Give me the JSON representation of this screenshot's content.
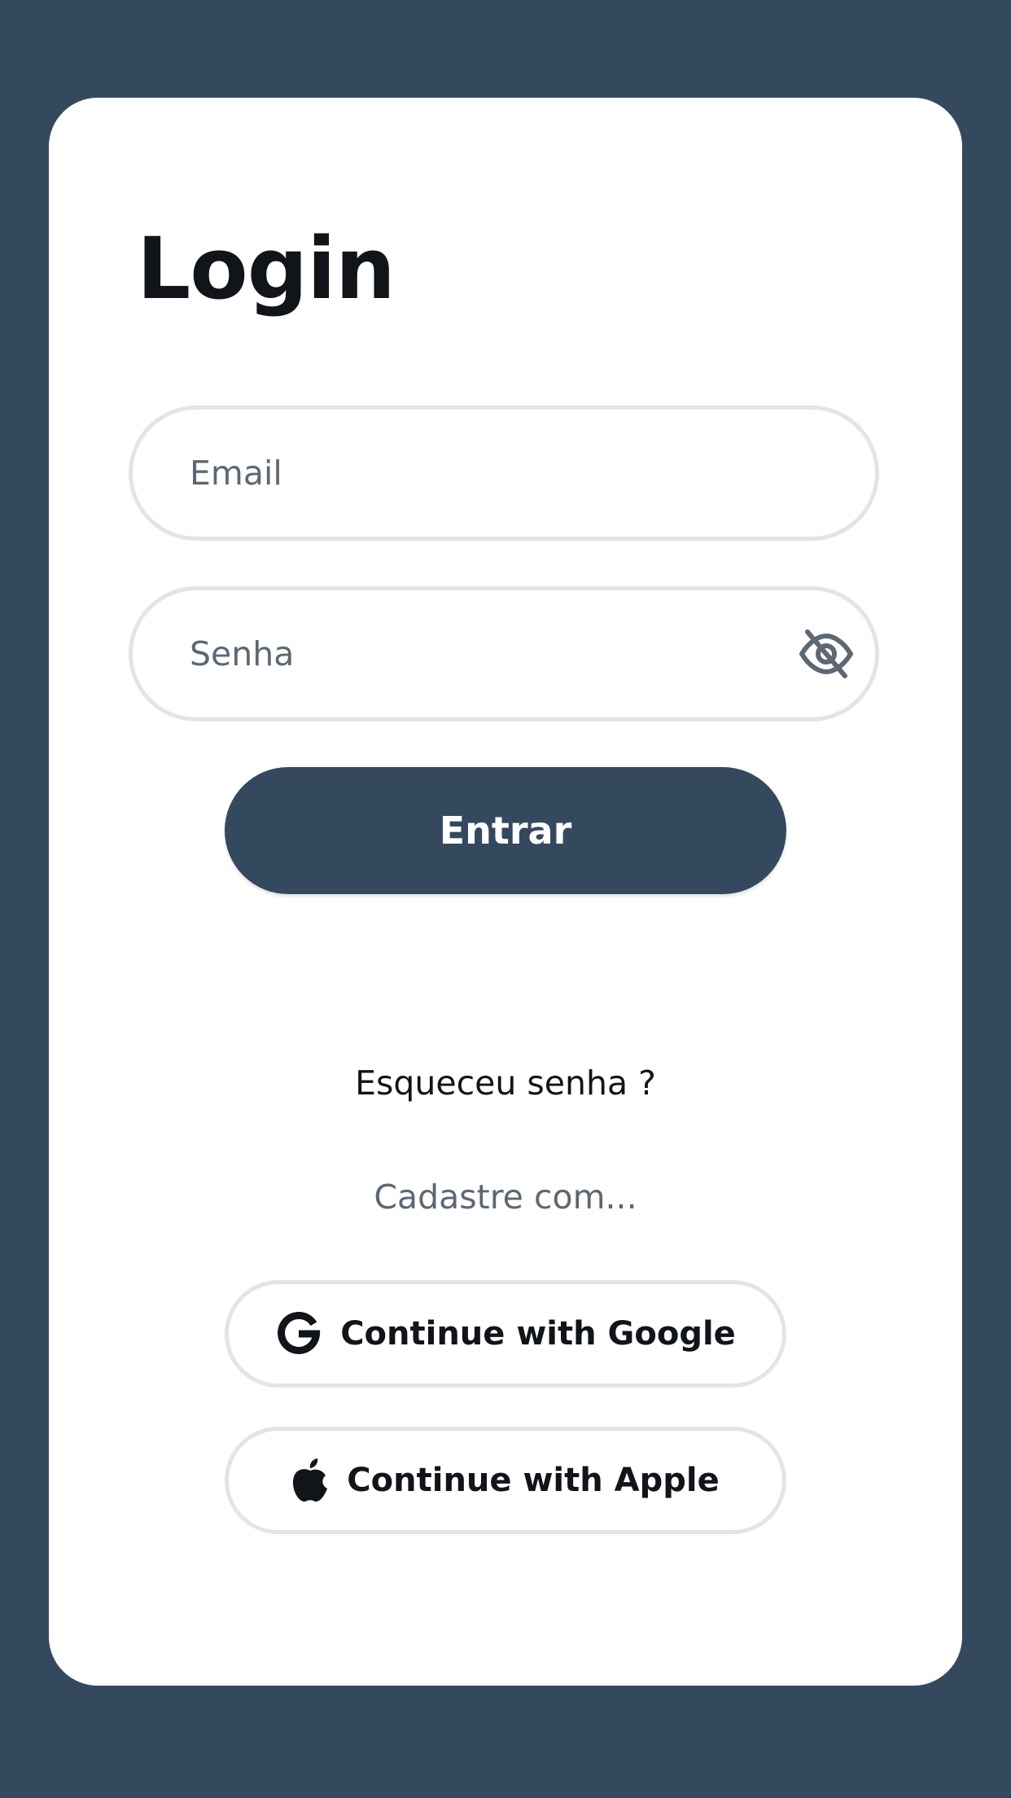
{
  "login": {
    "title": "Login",
    "email": {
      "placeholder": "Email",
      "value": ""
    },
    "password": {
      "placeholder": "Senha",
      "value": ""
    },
    "submit_label": "Entrar",
    "forgot_label": "Esqueceu senha ?",
    "register_label": "Cadastre com..."
  },
  "social": {
    "google_label": "Continue with Google",
    "apple_label": "Continue with Apple"
  },
  "icons": {
    "password_toggle": "eye-slash-icon",
    "google": "google-icon",
    "apple": "apple-icon"
  },
  "colors": {
    "background": "#35495e",
    "card": "#ffffff",
    "primary_button": "#35495e",
    "border": "#e2e4e8",
    "text": "#111418",
    "muted_text": "#5d6874"
  }
}
